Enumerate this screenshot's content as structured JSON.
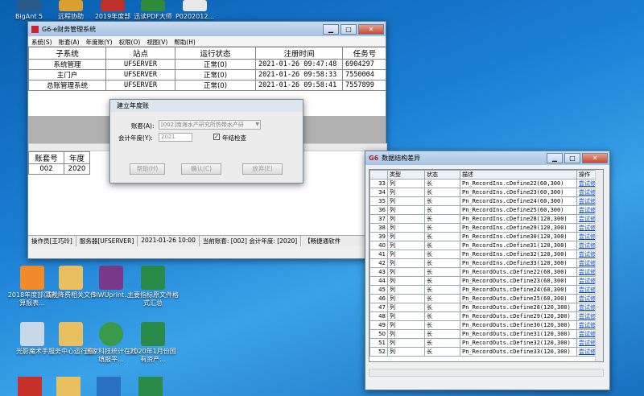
{
  "desktop_icons": [
    {
      "label": "BigAnt 5"
    },
    {
      "label": "远程协助"
    },
    {
      "label": "2019年度部"
    },
    {
      "label": "迅读PDF大师"
    },
    {
      "label": "P0202012..."
    },
    {
      "label": "2018年度部门决算报表..."
    },
    {
      "label": "减税降费相关文件"
    },
    {
      "label": "SIWUprint..."
    },
    {
      "label": "主要指标原文件格式汇总"
    },
    {
      "label": "光影魔术手"
    },
    {
      "label": "服务中心运行费"
    },
    {
      "label": "国家科技统计在线填报平..."
    },
    {
      "label": "2020年1月份国有资产..."
    }
  ],
  "main_window": {
    "title": "G6-e财务管理系统",
    "menu": [
      "系统(S)",
      "账套(A)",
      "年度账(Y)",
      "权限(O)",
      "视图(V)",
      "帮助(H)"
    ],
    "columns": [
      "子系统",
      "站点",
      "运行状态",
      "注册时间",
      "任务号"
    ],
    "rows": [
      [
        "系统管理",
        "UFSERVER",
        "正常(0)",
        "2021-01-26 09:47:48",
        "6904297"
      ],
      [
        "主门户",
        "UFSERVER",
        "正常(0)",
        "2021-01-26 09:58:33",
        "7550004"
      ],
      [
        "总账管理系统",
        "UFSERVER",
        "正常(0)",
        "2021-01-26 09:58:41",
        "7557899"
      ]
    ],
    "lower_columns": [
      "账套号",
      "年度"
    ],
    "lower_rows": [
      [
        "002",
        "2020"
      ]
    ],
    "status": [
      "操作员[王巧玲]",
      "服务器[UFSERVER]",
      "2021-01-26 10:00",
      "当前账套: [002] 会计年度: [2020]",
      "【畅捷通软件"
    ]
  },
  "dialog": {
    "title": "建立年度账",
    "account_label": "账套(A):",
    "account_value": "[002]南海水产研究所热带水产研",
    "year_label": "会计年度(Y):",
    "year_value": "2021",
    "check_label": "年结检查",
    "help_label": "帮助(H)",
    "ok_label": "确认(C)",
    "cancel_label": "放弃(E)"
  },
  "diff_window": {
    "title": "数据结构差异",
    "columns": [
      "",
      "类型",
      "状态",
      "描述",
      "操作"
    ],
    "rows": [
      [
        "33",
        "列",
        "长",
        "Pn_RecordIns.cDefine22(60,300)",
        "尝试修复"
      ],
      [
        "34",
        "列",
        "长",
        "Pn_RecordIns.cDefine23(60,300)",
        "尝试修复"
      ],
      [
        "35",
        "列",
        "长",
        "Pn_RecordIns.cDefine24(60,300)",
        "尝试修复"
      ],
      [
        "36",
        "列",
        "长",
        "Pn_RecordIns.cDefine25(60,300)",
        "尝试修复"
      ],
      [
        "37",
        "列",
        "长",
        "Pn_RecordIns.cDefine28(120,300)",
        "尝试修复"
      ],
      [
        "38",
        "列",
        "长",
        "Pn_RecordIns.cDefine29(120,300)",
        "尝试修复"
      ],
      [
        "39",
        "列",
        "长",
        "Pn_RecordIns.cDefine30(120,300)",
        "尝试修复"
      ],
      [
        "40",
        "列",
        "长",
        "Pn_RecordIns.cDefine31(120,300)",
        "尝试修复"
      ],
      [
        "41",
        "列",
        "长",
        "Pn_RecordIns.cDefine32(120,300)",
        "尝试修复"
      ],
      [
        "42",
        "列",
        "长",
        "Pn_RecordIns.cDefine33(120,300)",
        "尝试修复"
      ],
      [
        "43",
        "列",
        "长",
        "Pn_RecordOuts.cDefine22(60,300)",
        "尝试修复"
      ],
      [
        "44",
        "列",
        "长",
        "Pn_RecordOuts.cDefine23(60,300)",
        "尝试修复"
      ],
      [
        "45",
        "列",
        "长",
        "Pn_RecordOuts.cDefine24(60,300)",
        "尝试修复"
      ],
      [
        "46",
        "列",
        "长",
        "Pn_RecordOuts.cDefine25(60,300)",
        "尝试修复"
      ],
      [
        "47",
        "列",
        "长",
        "Pn_RecordOuts.cDefine28(120,300)",
        "尝试修复"
      ],
      [
        "48",
        "列",
        "长",
        "Pn_RecordOuts.cDefine29(120,300)",
        "尝试修复"
      ],
      [
        "49",
        "列",
        "长",
        "Pn_RecordOuts.cDefine30(120,300)",
        "尝试修复"
      ],
      [
        "50",
        "列",
        "长",
        "Pn_RecordOuts.cDefine31(120,300)",
        "尝试修复"
      ],
      [
        "51",
        "列",
        "长",
        "Pn_RecordOuts.cDefine32(120,300)",
        "尝试修复"
      ],
      [
        "52",
        "列",
        "长",
        "Pn_RecordOuts.cDefine33(120,300)",
        "尝试修复"
      ]
    ]
  }
}
